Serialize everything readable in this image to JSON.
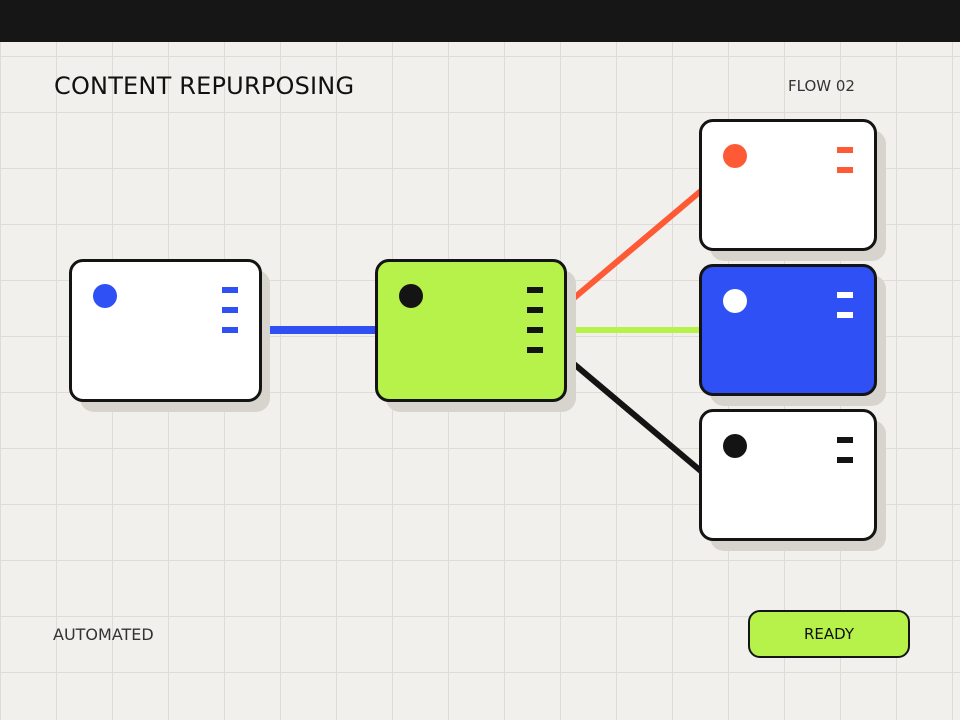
{
  "header": {
    "title": "CONTENT REPURPOSING",
    "flow_label": "FLOW 02"
  },
  "footer": {
    "status_label": "AUTOMATED",
    "ready_button": "READY"
  },
  "colors": {
    "background": "#f1f0ec",
    "grid": "#dedcd6",
    "topbar": "#161616",
    "outline": "#141414",
    "shadow": "#d6d4cc",
    "blue": "#2f50f5",
    "lime": "#b6f24a",
    "orange": "#fe5a35",
    "white": "#ffffff",
    "black": "#141414"
  },
  "nodes": [
    {
      "id": "source",
      "fill": "white",
      "dot": "blue",
      "handles": 3,
      "handle_color": "blue"
    },
    {
      "id": "processor",
      "fill": "lime",
      "dot": "black",
      "handles": 4,
      "handle_color": "black"
    },
    {
      "id": "output-orange",
      "fill": "white",
      "dot": "orange",
      "handles": 2,
      "handle_color": "orange"
    },
    {
      "id": "output-blue",
      "fill": "blue",
      "dot": "white",
      "handles": 2,
      "handle_color": "white"
    },
    {
      "id": "output-black",
      "fill": "white",
      "dot": "black",
      "handles": 2,
      "handle_color": "black"
    }
  ],
  "edges": [
    {
      "from": "source",
      "to": "processor",
      "color": "blue"
    },
    {
      "from": "processor",
      "to": "output-orange",
      "color": "orange"
    },
    {
      "from": "processor",
      "to": "output-blue",
      "color": "lime"
    },
    {
      "from": "processor",
      "to": "output-black",
      "color": "black"
    }
  ]
}
